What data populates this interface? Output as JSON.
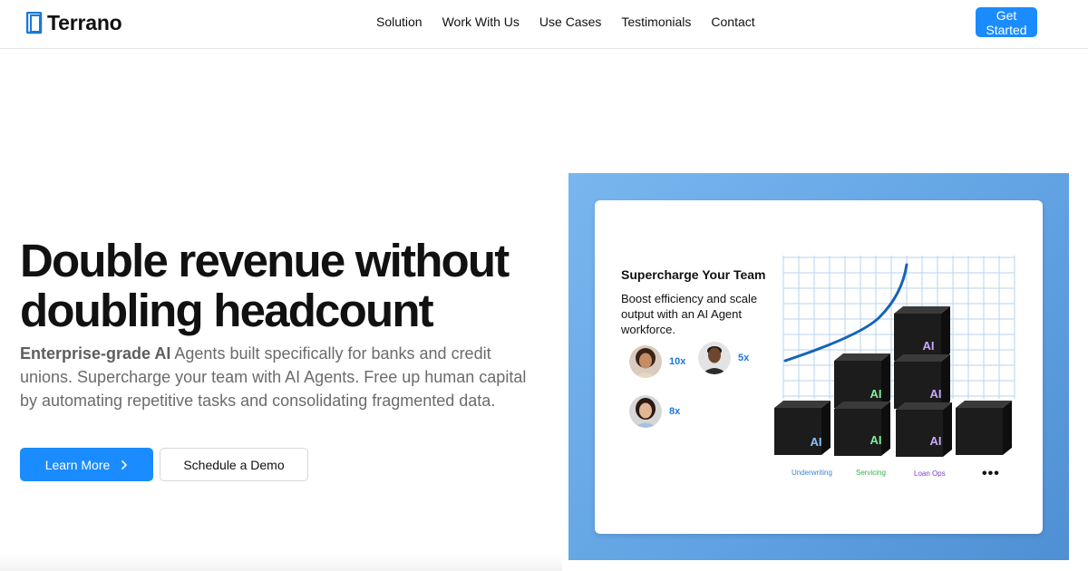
{
  "nav": {
    "brand": "Terrano",
    "links": [
      "Solution",
      "Work With Us",
      "Use Cases",
      "Testimonials",
      "Contact"
    ],
    "cta_label": "Get Started"
  },
  "hero": {
    "title_line1": "Double revenue without",
    "title_line2": "doubling headcount",
    "desc_bold": "Enterprise-grade AI",
    "desc_rest": " Agents built specifically for banks and credit unions. Supercharge your team with AI Agents. Free up human capital by automating repetitive tasks and consolidating fragmented data.",
    "primary_label": "Learn More",
    "secondary_label": "Schedule a Demo"
  },
  "illustration": {
    "title": "Supercharge Your Team",
    "subtitle": "Boost efficiency and scale output with an AI Agent workforce.",
    "multipliers": [
      "10x",
      "5x",
      "8x"
    ],
    "cube_label": "AI",
    "departments": [
      {
        "label": "Underwriting",
        "color": "#3b82d6"
      },
      {
        "label": "Servicing",
        "color": "#36b24a"
      },
      {
        "label": "Loan Ops",
        "color": "#7b3fc4"
      }
    ],
    "more": "•••"
  },
  "colors": {
    "accent": "#1a8cff",
    "panel": "#6aaae9",
    "cube": "#1c1c1c"
  }
}
